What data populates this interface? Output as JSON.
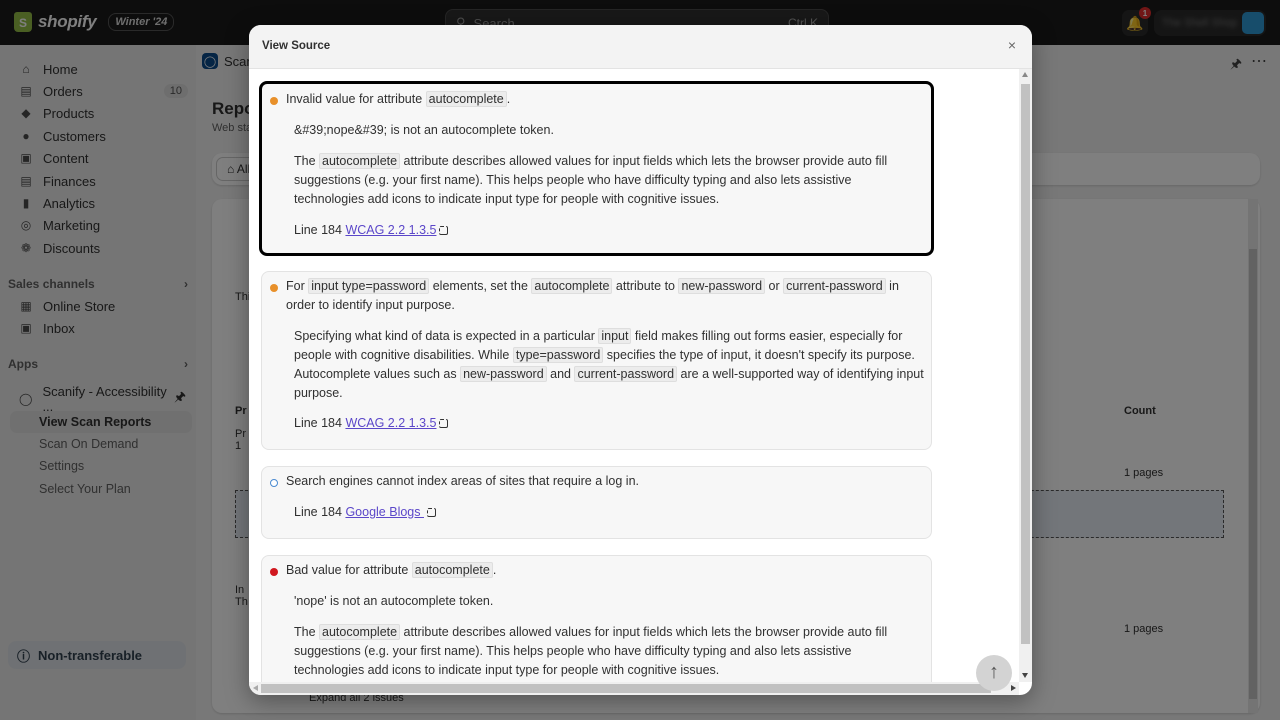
{
  "topbar": {
    "brand": "shopify",
    "edition_badge": "Winter '24",
    "search_placeholder": "Search",
    "search_shortcut": "Ctrl K",
    "notifications_count": "1",
    "store_name": "The Shell Shop"
  },
  "sidebar": {
    "items": [
      {
        "label": "Home",
        "icon": "home-icon"
      },
      {
        "label": "Orders",
        "icon": "orders-icon",
        "count": "10"
      },
      {
        "label": "Products",
        "icon": "tag-icon"
      },
      {
        "label": "Customers",
        "icon": "person-icon"
      },
      {
        "label": "Content",
        "icon": "content-icon"
      },
      {
        "label": "Finances",
        "icon": "bank-icon"
      },
      {
        "label": "Analytics",
        "icon": "bar-chart-icon"
      },
      {
        "label": "Marketing",
        "icon": "target-icon"
      },
      {
        "label": "Discounts",
        "icon": "discount-icon"
      }
    ],
    "sales_channels_title": "Sales channels",
    "sales_channels": [
      {
        "label": "Online Store",
        "icon": "store-icon"
      },
      {
        "label": "Inbox",
        "icon": "inbox-icon"
      }
    ],
    "apps_title": "Apps",
    "app": {
      "label": "Scanify - Accessibility ...",
      "sub_items": [
        {
          "label": "View Scan Reports",
          "active": true
        },
        {
          "label": "Scan On Demand",
          "active": false
        },
        {
          "label": "Settings",
          "active": false
        },
        {
          "label": "Select Your Plan",
          "active": false
        }
      ]
    },
    "settings_label": "Settings",
    "non_transferable_label": "Non-transferable"
  },
  "main": {
    "app_header": "Scanify - Accessibility",
    "page_title": "Reports",
    "page_subtitle": "Web standards",
    "home_tab": "All",
    "column_count_header": "Count",
    "column_prefix_header": "Pr",
    "row_values": [
      "1 pages",
      "1 pages"
    ],
    "expand_all_label": "Expand all 2 issues",
    "fragments": {
      "this": "Thi",
      "pr": "Pr",
      "one": "1",
      "in": "In",
      "th": "Th"
    }
  },
  "modal": {
    "title": "View Source",
    "close_label": "×",
    "issues": [
      {
        "severity": "warning",
        "heading": [
          "Invalid value for attribute ",
          {
            "code": "autocomplete"
          },
          "."
        ],
        "detail": "&#39;nope&#39; is not an autocomplete token.",
        "description": [
          "The ",
          {
            "code": "autocomplete"
          },
          " attribute describes allowed values for input fields which lets the browser provide auto fill suggestions (e.g. your first name). This helps people who have difficulty typing and also lets assistive technologies add icons to indicate input type for people with cognitive issues."
        ],
        "line_label": "Line 184",
        "link_text": "WCAG 2.2 1.3.5"
      },
      {
        "severity": "warning",
        "heading": [
          "For ",
          {
            "code": "input type=password"
          },
          " elements, set the ",
          {
            "code": "autocomplete"
          },
          " attribute to ",
          {
            "code": "new-password"
          },
          " or ",
          {
            "code": "current-password"
          },
          " in order to identify input purpose."
        ],
        "description": [
          "Specifying what kind of data is expected in a particular ",
          {
            "code": "input"
          },
          " field makes filling out forms easier, especially for people with cognitive disabilities. While ",
          {
            "code": "type=password"
          },
          " specifies the type of input, it doesn't specify its purpose. Autocomplete values such as ",
          {
            "code": "new-password"
          },
          " and ",
          {
            "code": "current-password"
          },
          " are a well-supported way of identifying input purpose."
        ],
        "line_label": "Line 184",
        "link_text": "WCAG 2.2 1.3.5"
      },
      {
        "severity": "info",
        "heading": [
          "Search engines cannot index areas of sites that require a log in."
        ],
        "line_label": "Line 184",
        "link_text": "Google Blogs "
      },
      {
        "severity": "error",
        "heading": [
          "Bad value for attribute ",
          {
            "code": "autocomplete"
          },
          "."
        ],
        "detail": "'nope' is not an autocomplete token.",
        "description": [
          "The ",
          {
            "code": "autocomplete"
          },
          " attribute describes allowed values for input fields which lets the browser provide auto fill suggestions (e.g. your first name). This helps people who have difficulty typing and also lets assistive technologies add icons to indicate input type for people with cognitive issues."
        ]
      }
    ],
    "scroll_to_top_icon": "arrow-up-icon"
  },
  "colors": {
    "warning": "#e8902a",
    "error": "#d0181f",
    "info": "#4a8ad0",
    "link": "#5b47c9"
  }
}
